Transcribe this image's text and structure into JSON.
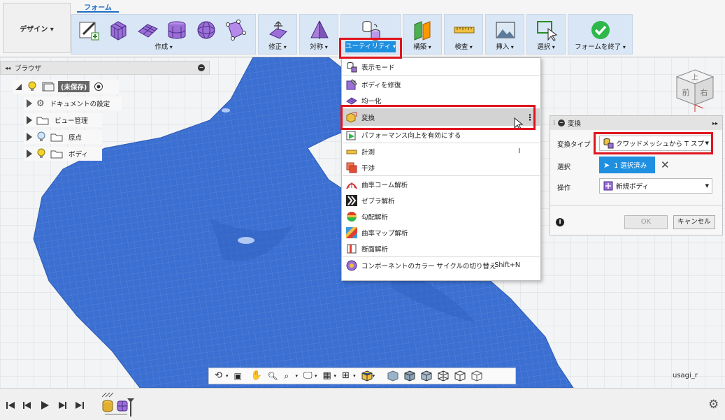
{
  "workspace": {
    "label": "デザイン ▾"
  },
  "active_tab": "フォーム",
  "toolbar_groups": [
    {
      "label": "作成"
    },
    {
      "label": "修正"
    },
    {
      "label": "対称"
    },
    {
      "label": "ユーティリティ"
    },
    {
      "label": "構築"
    },
    {
      "label": "検査"
    },
    {
      "label": "挿入"
    },
    {
      "label": "選択"
    },
    {
      "label": "フォームを終了"
    }
  ],
  "browser": {
    "title": "ブラウザ",
    "root": "(未保存)",
    "items": [
      "ドキュメントの設定",
      "ビュー管理",
      "原点",
      "ボディ"
    ]
  },
  "utility_menu": {
    "items": [
      {
        "label": "表示モード",
        "shortcut": ""
      },
      {
        "label": "ボディを修復",
        "shortcut": ""
      },
      {
        "label": "均一化",
        "shortcut": ""
      },
      {
        "label": "変換",
        "shortcut": ""
      },
      {
        "label": "パフォーマンス向上を有効にする",
        "shortcut": ""
      },
      {
        "label": "計測",
        "shortcut": "I"
      },
      {
        "label": "干渉",
        "shortcut": ""
      },
      {
        "label": "曲率コーム解析",
        "shortcut": ""
      },
      {
        "label": "ゼブラ解析",
        "shortcut": ""
      },
      {
        "label": "勾配解析",
        "shortcut": ""
      },
      {
        "label": "曲率マップ解析",
        "shortcut": ""
      },
      {
        "label": "断面解析",
        "shortcut": ""
      },
      {
        "label": "コンポーネントのカラー サイクルの切り替え",
        "shortcut": "Shift+N"
      }
    ]
  },
  "transform_panel": {
    "title": "変換",
    "type_label": "変換タイプ",
    "type_value": "クワッドメッシュから T スプライ...",
    "select_label": "選択",
    "select_value": "1 選択済み",
    "operation_label": "操作",
    "operation_value": "新規ボディ",
    "ok": "OK",
    "cancel": "キャンセル"
  },
  "view_cube": {
    "top": "上",
    "front": "前",
    "right": "右"
  },
  "model_name": "usagi_r",
  "colors": {
    "mesh": "#3a6fd0",
    "highlight_red": "#e0141e",
    "accent_blue": "#1f8fe0",
    "toolbar_group": "#d9e6f5"
  }
}
